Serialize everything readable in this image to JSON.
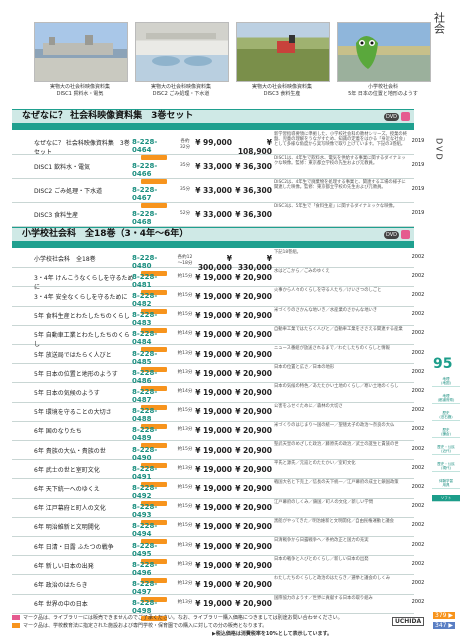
{
  "side": {
    "label": "社会",
    "sub": "DVD"
  },
  "page_num": "95",
  "photos": [
    {
      "caption_lines": [
        "実物大の社会科映像資料集",
        "DISC1 貿料水・電気"
      ]
    },
    {
      "caption_lines": [
        "実物大の社会科映像資料集",
        "DISC2 ごみ処理・下水道"
      ]
    },
    {
      "caption_lines": [
        "実物大の社会科映像資料集",
        "DISC3 食料生産"
      ]
    },
    {
      "caption_lines": [
        "小学校社会科",
        "5年 日本の位置と地形のようす"
      ]
    }
  ],
  "section1": {
    "title": "なぜなに？ 社会科映像資料集　3巻セット",
    "rows": [
      {
        "title": "なぜなに？ 社会科映像資料集　3巻セット",
        "code": "8-228-0464",
        "min": "各約\n32分",
        "p1": "¥ 99,000",
        "p2": "¥ 108,900",
        "desc": "新学習指導要領に準拠した、小学校社会科の教材シリーズ。授業の終盤、児童の理解をうながすため、知識の定着をはかる「身近な社会」として多様な角度から実写映像で取り上げています。下記の3巻組。",
        "year": "2019"
      },
      {
        "title": "DISC1 飲料水・電気",
        "code": "8-228-0466",
        "min": "35分",
        "p1": "¥ 33,000",
        "p2": "¥ 36,300",
        "desc": "DISC1は、4年生で飲料水、電気を供給する事業に関するダイナミックな映像。監修：東京都立学校の先生および元教員。",
        "year": "2019"
      },
      {
        "title": "DISC2 ごみ処理・下水道",
        "code": "8-228-0467",
        "min": "35分",
        "p1": "¥ 33,000",
        "p2": "¥ 36,300",
        "desc": "DISC2は、4年生で廃棄物を処理する事業と、関連する工場の様子に関連した映像。監修：東京都立学校の先生および元教員。",
        "year": "2019"
      },
      {
        "title": "DISC3 食料生産",
        "code": "8-228-0468",
        "min": "52分",
        "p1": "¥ 33,000",
        "p2": "¥ 36,300",
        "desc": "DISC3は、5年生で「食料生産」に関するダイナミックな映像。",
        "year": "2019"
      }
    ]
  },
  "section2": {
    "title": "小学校社会科　全18巻（3・4年〜6年）",
    "rows": [
      {
        "title": "小学校社会科　全18巻",
        "code": "8-228-0480",
        "min": "各約12\n〜18分",
        "p1": "¥ 300,000",
        "p2": "¥ 330,000",
        "desc": "下記18巻組。",
        "year": "2002"
      },
      {
        "title": "3・4年 けんこうなくらしを守るために",
        "code": "8-228-0481",
        "min": "約15分",
        "p1": "¥ 19,000",
        "p2": "¥ 20,900",
        "desc": "水はどこから／ごみのゆくえ",
        "year": "2002"
      },
      {
        "title": "3・4年 安全なくらしを守るために",
        "code": "8-228-0482",
        "min": "約15分",
        "p1": "¥ 19,000",
        "p2": "¥ 20,900",
        "desc": "火事から人々のくらしを守る人たち／けいさつのしごと",
        "year": "2002"
      },
      {
        "title": "5年 食料生産とわたしたちのくらし",
        "code": "8-228-0483",
        "min": "約15分",
        "p1": "¥ 19,000",
        "p2": "¥ 20,900",
        "desc": "米づくりのさかんな地いき／水産業のさかんな地いき",
        "year": "2002"
      },
      {
        "title": "5年 自動車工業とわたしたちのくらし",
        "code": "8-228-0484",
        "min": "約14分",
        "p1": "¥ 19,000",
        "p2": "¥ 20,900",
        "desc": "自動車工業ではたらく人びと／自動車工業をささえる関連する産業",
        "year": "2002"
      },
      {
        "title": "5年 放送局ではたらく人びと",
        "code": "8-228-0485",
        "min": "約13分",
        "p1": "¥ 19,000",
        "p2": "¥ 20,900",
        "desc": "ニュース番組が放送されるまで／わたしたちのくらしと情報",
        "year": "2002"
      },
      {
        "title": "5年 日本の位置と地形のようす",
        "code": "8-228-0486",
        "min": "約13分",
        "p1": "¥ 19,000",
        "p2": "¥ 20,900",
        "desc": "日本の位置と広さ／日本の地形",
        "year": "2002"
      },
      {
        "title": "5年 日本の気候のようす",
        "code": "8-228-0487",
        "min": "約14分",
        "p1": "¥ 19,000",
        "p2": "¥ 20,900",
        "desc": "日本の気候の特色／あたたかい土地のくらし／寒い土地のくらし",
        "year": "2002"
      },
      {
        "title": "5年 環境を守ることの大切さ",
        "code": "8-228-0488",
        "min": "約15分",
        "p1": "¥ 19,000",
        "p2": "¥ 20,900",
        "desc": "公害をふせぐために／森林の大切さ",
        "year": "2002"
      },
      {
        "title": "6年 国のなりたち",
        "code": "8-228-0489",
        "min": "約13分",
        "p1": "¥ 19,000",
        "p2": "¥ 20,900",
        "desc": "米づくりのはじまり〜国の統一／聖徳太子の政治〜奈良の大仏",
        "year": "2002"
      },
      {
        "title": "6年 貴族の大仏・貴族の世",
        "code": "8-228-0490",
        "min": "約15分",
        "p1": "¥ 19,000",
        "p2": "¥ 20,900",
        "desc": "聖武天皇のめざした政治／藤原氏の政治／武士の誕生と貴族の世",
        "year": "2002"
      },
      {
        "title": "6年 武士の世と室町文化",
        "code": "8-228-0491",
        "min": "約13分",
        "p1": "¥ 19,000",
        "p2": "¥ 20,900",
        "desc": "平氏と源氏／元寇とのたたかい／室町文化",
        "year": "2002"
      },
      {
        "title": "6年 天下統一へのゆくえ",
        "code": "8-228-0492",
        "min": "約15分",
        "p1": "¥ 19,000",
        "p2": "¥ 20,900",
        "desc": "戦国大名と下克上／信長の天下統一／江戸幕府の成立と鎖国政策",
        "year": "2002"
      },
      {
        "title": "6年 江戸幕府と町人の文化",
        "code": "8-228-0493",
        "min": "約15分",
        "p1": "¥ 19,000",
        "p2": "¥ 20,900",
        "desc": "江戸幕府のしくみ／鎖国／町人の文化／新しい学問",
        "year": "2002"
      },
      {
        "title": "6年 明治維新と文明開化",
        "code": "8-228-0494",
        "min": "約15分",
        "p1": "¥ 19,000",
        "p2": "¥ 20,900",
        "desc": "黒船がやってきた／明治維新と文明開化／自由民権運動と議会",
        "year": "2002"
      },
      {
        "title": "6年 日清・日露 ふたつの戦争",
        "code": "8-228-0495",
        "min": "約13分",
        "p1": "¥ 19,000",
        "p2": "¥ 20,900",
        "desc": "日清戦争から日露戦争へ／条約改正と国力の充実",
        "year": "2002"
      },
      {
        "title": "6年 新しい日本の出発",
        "code": "8-228-0496",
        "min": "約13分",
        "p1": "¥ 19,000",
        "p2": "¥ 20,900",
        "desc": "日本の戦争と人びとのくらし／新しい日本の出発",
        "year": "2002"
      },
      {
        "title": "6年 政治のはたらき",
        "code": "8-228-0497",
        "min": "約12分",
        "p1": "¥ 19,000",
        "p2": "¥ 20,900",
        "desc": "わたしたちのくらしと政治のはたらき／選挙と議会のしくみ",
        "year": "2002"
      },
      {
        "title": "6年 世界の中の日本",
        "code": "8-228-0498",
        "min": "約13分",
        "p1": "¥ 19,000",
        "p2": "¥ 20,900",
        "desc": "国際協力のようす／世界に貢献する日本の取り組み",
        "year": "2002"
      }
    ]
  },
  "side_tabs": [
    "地理\n(地図)",
    "地理\n(都道府県)",
    "歴史\n(旧石器)",
    "歴史\n(鎌倉)",
    "歴史・公民\n(近代)",
    "歴史・公民\n(現代)",
    "体験学習\n用具",
    "ソフト"
  ],
  "notes": {
    "line1": "マーク品は、ライブラリーには販売できませんのでご了承ください。なお、ライブラリー購入価格につきましては別途お問い合わせください。",
    "line2": "マーク品は、学校教育法に指定された施設および専門学校・保育園での購入に対しての分の販売となります。",
    "tax": "▶税込価格は消費税率を10%として表示しています。"
  },
  "footer": {
    "p1": "379 ▶",
    "p2": "347 ▶",
    "brand": "UCHIDA"
  }
}
